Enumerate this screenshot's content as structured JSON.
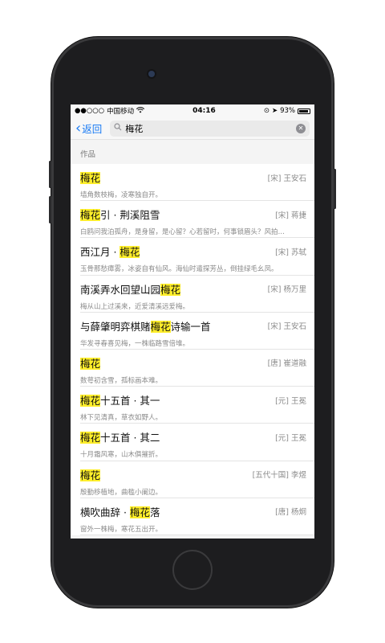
{
  "status": {
    "carrier": "中国移动",
    "time": "04:16",
    "battery": "93%"
  },
  "nav": {
    "back_label": "返回",
    "search_value": "梅花"
  },
  "section_title": "作品",
  "results": [
    {
      "pre": "",
      "hl": "梅花",
      "post": "",
      "author": "[宋] 王安石",
      "excerpt": "墙角数枝梅，凌寒独自开。"
    },
    {
      "pre": "",
      "hl": "梅花",
      "post": "引 · 荆溪阻雪",
      "author": "[宋] 蒋捷",
      "excerpt": "白鸥问我泊孤舟，是身留，是心留？心若留时，何事锁眉头？风拍…"
    },
    {
      "pre": "西江月 · ",
      "hl": "梅花",
      "post": "",
      "author": "[宋] 苏轼",
      "excerpt": "玉骨那愁瘴雾，冰姿自有仙风。海仙时遣探芳丛，倒挂绿毛幺凤。"
    },
    {
      "pre": "南溪弄水回望山园",
      "hl": "梅花",
      "post": "",
      "author": "[宋] 杨万里",
      "excerpt": "梅从山上过溪来，近爱清溪远爱梅。"
    },
    {
      "pre": "与薛肇明弈棋赌",
      "hl": "梅花",
      "post": "诗输一首",
      "author": "[宋] 王安石",
      "excerpt": "华发寻春喜见梅，一株临路雪倍堆。"
    },
    {
      "pre": "",
      "hl": "梅花",
      "post": "",
      "author": "[唐] 崔道融",
      "excerpt": "数萼初含雪，孤标画本难。"
    },
    {
      "pre": "",
      "hl": "梅花",
      "post": "十五首 · 其一",
      "author": "[元] 王冕",
      "excerpt": "林下见清真，草衣如野人。"
    },
    {
      "pre": "",
      "hl": "梅花",
      "post": "十五首 · 其二",
      "author": "[元] 王冕",
      "excerpt": "十月霜风寒，山木俱摧折。"
    },
    {
      "pre": "",
      "hl": "梅花",
      "post": "",
      "author": "[五代十国] 李煜",
      "excerpt": "殷勤移植地，曲槛小阑边。"
    },
    {
      "pre": "横吹曲辞 · ",
      "hl": "梅花",
      "post": "落",
      "author": "[唐] 杨炯",
      "excerpt": "窗外一株梅，寒花五出开。"
    }
  ]
}
